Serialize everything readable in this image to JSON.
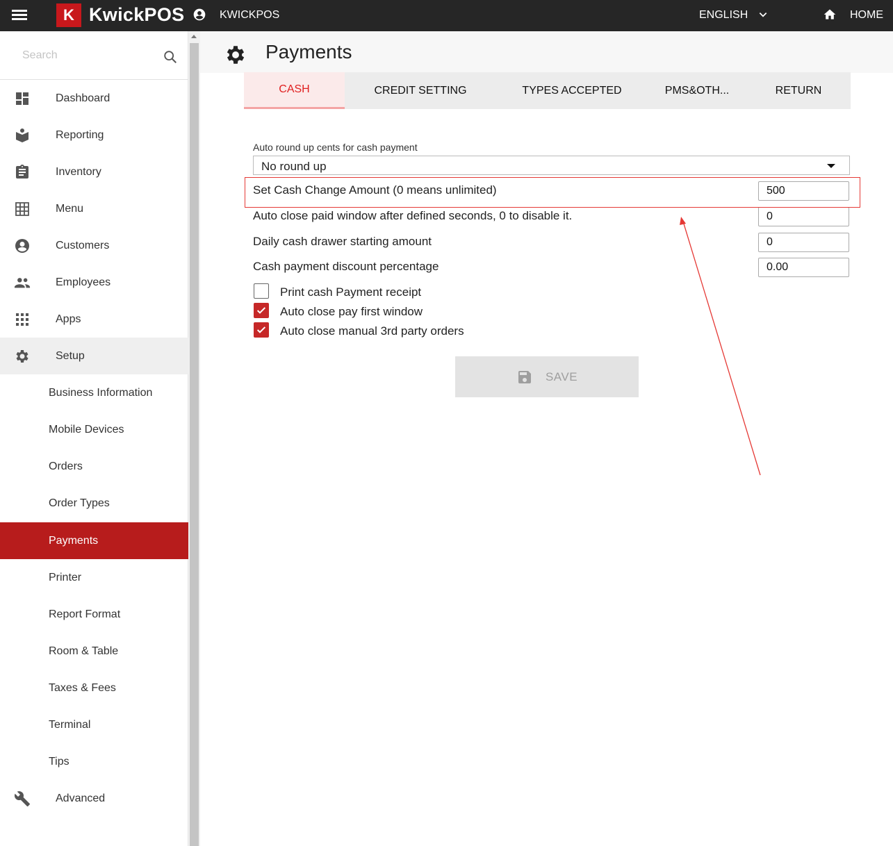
{
  "header": {
    "logo_letter": "K",
    "logo_text": "KwickPOS",
    "account_name": "KWICKPOS",
    "language": "ENGLISH",
    "home_label": "HOME"
  },
  "sidebar": {
    "search_placeholder": "Search",
    "items": [
      {
        "label": "Dashboard",
        "icon": "dashboard-icon"
      },
      {
        "label": "Reporting",
        "icon": "reporting-icon"
      },
      {
        "label": "Inventory",
        "icon": "clipboard-icon"
      },
      {
        "label": "Menu",
        "icon": "grid-icon"
      },
      {
        "label": "Customers",
        "icon": "account-circle-icon"
      },
      {
        "label": "Employees",
        "icon": "people-icon"
      },
      {
        "label": "Apps",
        "icon": "apps-icon"
      },
      {
        "label": "Setup",
        "icon": "gear-icon"
      }
    ],
    "setup_children": [
      "Business Information",
      "Mobile Devices",
      "Orders",
      "Order Types",
      "Payments",
      "Printer",
      "Report Format",
      "Room & Table",
      "Taxes & Fees",
      "Terminal",
      "Tips"
    ],
    "advanced_label": "Advanced",
    "active_item": "Payments"
  },
  "page": {
    "title": "Payments",
    "tabs": [
      "CASH",
      "CREDIT SETTING",
      "TYPES ACCEPTED",
      "PMS&OTH...",
      "RETURN"
    ],
    "active_tab": "CASH"
  },
  "form": {
    "round_up_label": "Auto round up cents for cash payment",
    "round_up_value": "No round up",
    "fields": [
      {
        "label": "Set Cash Change Amount (0 means unlimited)",
        "value": "500"
      },
      {
        "label": "Auto close paid window after defined seconds, 0 to disable it.",
        "value": "0"
      },
      {
        "label": "Daily cash drawer starting amount",
        "value": "0"
      },
      {
        "label": "Cash payment discount percentage",
        "value": "0.00"
      }
    ],
    "checkboxes": [
      {
        "label": "Print cash Payment receipt",
        "checked": false
      },
      {
        "label": "Auto close pay first window",
        "checked": true
      },
      {
        "label": "Auto close manual 3rd party orders",
        "checked": true
      }
    ],
    "save_label": "SAVE"
  },
  "colors": {
    "brand_red": "#c8181c",
    "active_nav": "#b71c1c",
    "annotation_red": "#e53935"
  }
}
